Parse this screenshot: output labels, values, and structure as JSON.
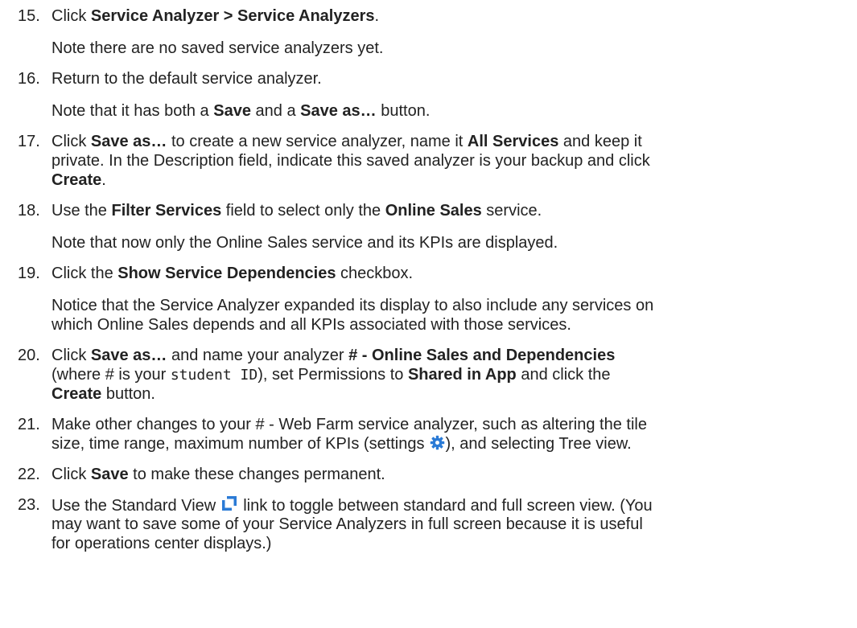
{
  "steps": [
    {
      "number": "15.",
      "pre": "Click ",
      "bold": "Service Analyzer > Service Analyzers",
      "post": ".",
      "note": "Note there are no saved service analyzers yet."
    },
    {
      "number": "16.",
      "text": "Return to the default service analyzer.",
      "note_pre": "Note that it has both a ",
      "note_bold1": "Save",
      "note_mid": " and a ",
      "note_bold2": "Save as…",
      "note_post": " button."
    },
    {
      "number": "17.",
      "l1_pre": "Click ",
      "l1_bold1": "Save as…",
      "l1_mid": " to create a new service analyzer, name it ",
      "l1_bold2": "All Services",
      "l1_post": " and keep it",
      "l2": "private. In the Description field, indicate this saved analyzer is your backup and click",
      "l3_bold": "Create",
      "l3_post": "."
    },
    {
      "number": "18.",
      "pre": "Use the ",
      "bold1": "Filter Services",
      "mid": " field to select only the ",
      "bold2": "Online Sales",
      "post": " service.",
      "note": "Note that now only the Online Sales service and its KPIs are displayed."
    },
    {
      "number": "19.",
      "pre": "Click the ",
      "bold": "Show Service Dependencies",
      "post": " checkbox.",
      "note_l1": "Notice that the Service Analyzer expanded its display to also include any services on",
      "note_l2": "which Online Sales depends and all KPIs associated with those services."
    },
    {
      "number": "20.",
      "l1_pre": "Click ",
      "l1_bold1": "Save as…",
      "l1_mid": " and name your analyzer ",
      "l1_bold2": "# - Online Sales and Dependencies",
      "l2_pre": "(where # is your ",
      "l2_mono": "student ID",
      "l2_mid": "), set Permissions to ",
      "l2_bold": "Shared in App",
      "l2_post": " and click the",
      "l3_bold": "Create",
      "l3_post": " button."
    },
    {
      "number": "21.",
      "l1": "Make other changes to your # - Web Farm service analyzer, such as altering the tile",
      "l2_pre": "size, time range, maximum number of KPIs (settings",
      "l2_post": "), and selecting Tree view."
    },
    {
      "number": "22.",
      "pre": "Click ",
      "bold": "Save",
      "post": " to make these changes permanent."
    },
    {
      "number": "23.",
      "l1_pre": "Use the Standard View",
      "l1_post": "link to toggle between standard and full screen view. (You",
      "l2": "may want to save some of your Service Analyzers in full screen because it is useful",
      "l3": "for operations center displays.)"
    }
  ],
  "icons": {
    "settings": "gear-icon",
    "standard_view": "expand-icon",
    "accent_color": "#2b7bd6"
  }
}
